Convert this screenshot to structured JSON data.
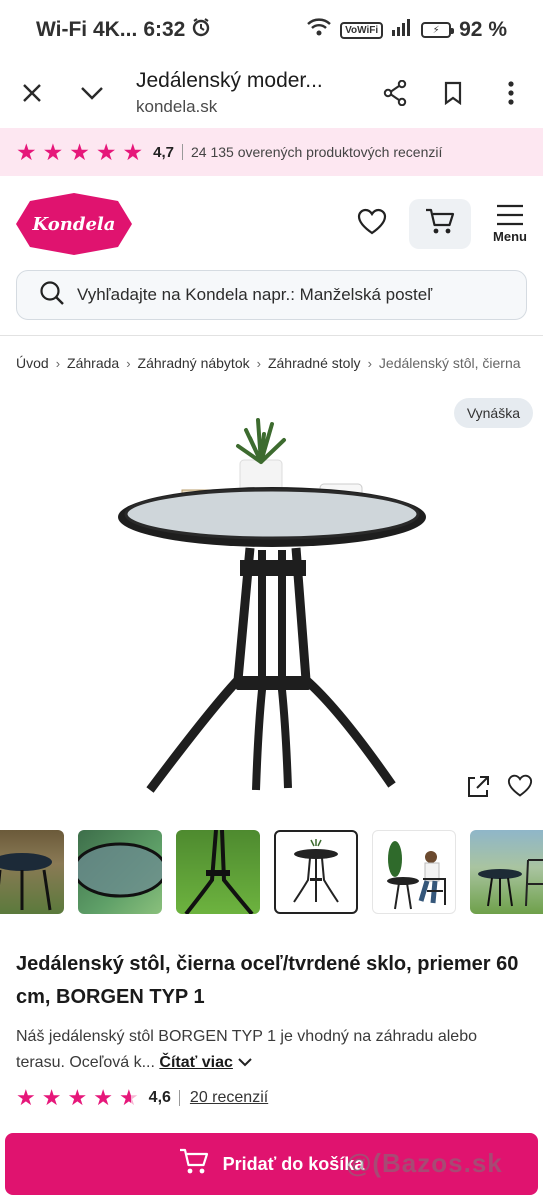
{
  "status_bar": {
    "left_text": "Wi-Fi 4K...",
    "time": "6:32",
    "volte": "VoWiFi",
    "battery_percent": "92 %"
  },
  "browser": {
    "page_title": "Jedálenský moder...",
    "url": "kondela.sk"
  },
  "rating_banner": {
    "stars": 5,
    "score": "4,7",
    "reviews_text": "24 135 overených produktových recenzií"
  },
  "header": {
    "logo_text": "Kondela",
    "menu_label": "Menu",
    "brand_color": "#e0136f"
  },
  "search": {
    "placeholder": "Vyhľadajte na Kondela napr.: Manželská posteľ"
  },
  "breadcrumb": [
    "Úvod",
    "Záhrada",
    "Záhradný nábytok",
    "Záhradné stoly",
    "Jedálenský stôl, čierna"
  ],
  "gallery": {
    "badge": "Vynáška",
    "thumbnails": [
      "table-in-garden",
      "glass-tabletop-closeup",
      "table-legs-on-grass",
      "table-studio-shot",
      "woman-sitting-by-table",
      "table-and-chair-on-lawn"
    ],
    "active_thumbnail": 3
  },
  "product": {
    "title": "Jedálenský stôl, čierna oceľ/tvrdené sklo, priemer 60 cm, BORGEN TYP 1",
    "description": "Náš jedálenský stôl BORGEN TYP 1 je vhodný na záhradu alebo terasu. Oceľová k...",
    "read_more": "Čítať viac",
    "rating_stars": 4.6,
    "rating_score": "4,6",
    "reviews_link": "20 recenzií"
  },
  "cta": {
    "add_to_cart": "Pridať do košíka"
  },
  "watermark": "Bazos.sk"
}
